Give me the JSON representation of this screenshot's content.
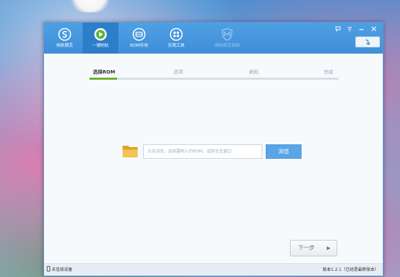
{
  "nav": {
    "tabs": [
      {
        "label": "刷机精灵",
        "icon": "shield-s-icon",
        "active": false,
        "disabled": false
      },
      {
        "label": "一键刷机",
        "icon": "play-icon",
        "active": true,
        "disabled": false
      },
      {
        "label": "ROM市场",
        "icon": "disk-icon",
        "active": false,
        "disabled": false
      },
      {
        "label": "实用工具",
        "icon": "grid-icon",
        "active": false,
        "disabled": false
      },
      {
        "label": "刷机精灵官网",
        "icon": "m-shield-icon",
        "active": false,
        "disabled": true
      }
    ]
  },
  "window_controls": [
    "skin-icon",
    "menu-icon",
    "minimize-icon",
    "close-icon"
  ],
  "steps": {
    "items": [
      "选择ROM",
      "选项",
      "刷机",
      "完成"
    ],
    "current_index": 0,
    "progress": 0.11
  },
  "file_chooser": {
    "placeholder": "点击浏览，选择要刷入的ROM，或拖至此窗口",
    "value": "",
    "browse_label": "浏览"
  },
  "next_button": {
    "label": "下一步",
    "arrow": "▶"
  },
  "status": {
    "device": "未连接设备",
    "version": "版本1.2.1（已经是最新版本）"
  },
  "colors": {
    "titlebar": "#4f9fe3",
    "active_tab": "#2c7ec9",
    "progress": "#6dae2c",
    "browse": "#58a6e6"
  }
}
